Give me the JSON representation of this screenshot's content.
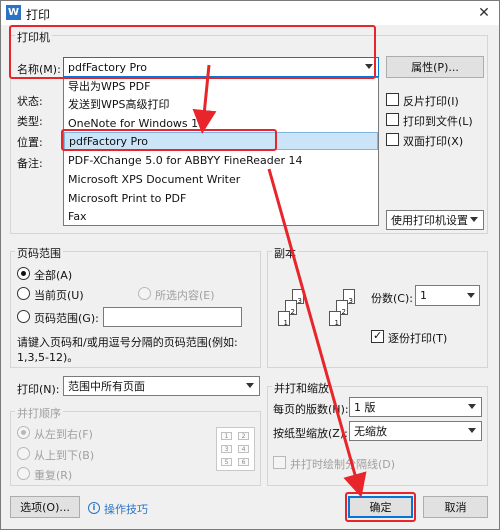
{
  "window": {
    "title": "打印",
    "app_icon": "W",
    "close": "✕"
  },
  "printer": {
    "group_label": "打印机",
    "name_label": "名称(M):",
    "name_value": "pdfFactory Pro",
    "properties_button": "属性(P)...",
    "status_label": "状态:",
    "type_label": "类型:",
    "location_label": "位置:",
    "comment_label": "备注:",
    "dropdown_items": [
      "导出为WPS PDF",
      "发送到WPS高级打印",
      "OneNote for Windows 10",
      "pdfFactory Pro",
      "PDF-XChange 5.0 for ABBYY FineReader 14",
      "Microsoft XPS Document Writer",
      "Microsoft Print to PDF",
      "Fax"
    ],
    "selected_index": 3,
    "reverse_print": "反片打印(I)",
    "print_to_file": "打印到文件(L)",
    "duplex": "双面打印(X)",
    "use_printer_settings": "使用打印机设置"
  },
  "page_range": {
    "group_label": "页码范围",
    "all": "全部(A)",
    "current": "当前页(U)",
    "selection": "所选内容(E)",
    "range": "页码范围(G):",
    "range_value": "",
    "hint_line1": "请键入页码和/或用逗号分隔的页码范围(例如:",
    "hint_line2": "1,3,5-12)。"
  },
  "copies": {
    "group_label": "副本",
    "count_label": "份数(C):",
    "count_value": "1",
    "collate": "逐份打印(T)",
    "page_nums": [
      "1",
      "2",
      "3"
    ]
  },
  "print_what": {
    "label": "打印(N):",
    "value": "范围中所有页面"
  },
  "print_order": {
    "group_label": "并打顺序",
    "left_to_right": "从左到右(F)",
    "top_to_bottom": "从上到下(B)",
    "repeat": "重复(R)",
    "grid_nums": [
      "1",
      "2",
      "3",
      "4",
      "5",
      "6"
    ]
  },
  "zoom": {
    "group_label": "并打和缩放",
    "pages_per_sheet_label": "每页的版数(H):",
    "pages_per_sheet_value": "1 版",
    "scale_label": "按纸型缩放(Z):",
    "scale_value": "无缩放",
    "draw_borders": "并打时绘制分隔线(D)"
  },
  "footer": {
    "options_button": "选项(O)...",
    "tips_link": "操作技巧",
    "ok_button": "确定",
    "cancel_button": "取消"
  },
  "colors": {
    "highlight": "#e8252b",
    "selection_bg": "#cce4f7",
    "accent_blue": "#0078d7"
  }
}
